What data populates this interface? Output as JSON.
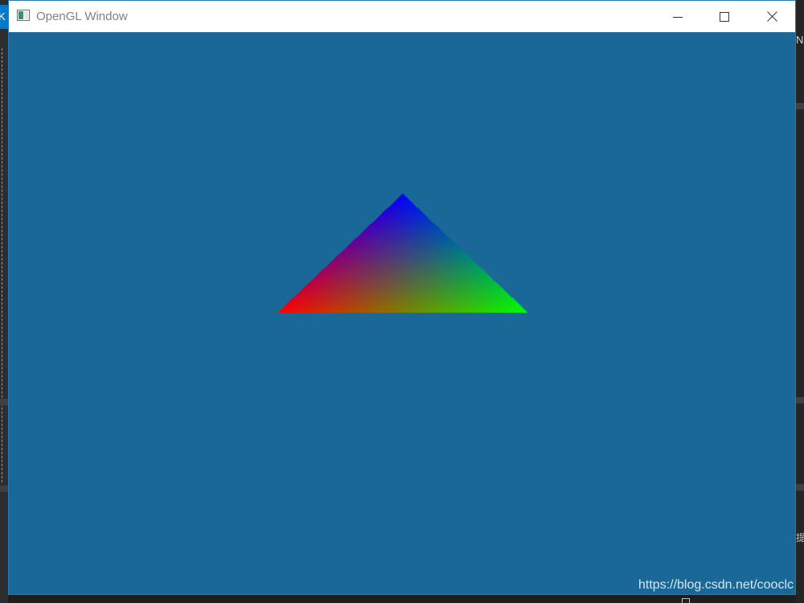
{
  "window": {
    "title": "OpenGL Window",
    "app_icon": "window-app-icon",
    "background_color": "#1a6898",
    "controls": {
      "minimize_icon": "minimize-icon",
      "maximize_icon": "maximize-icon",
      "close_icon": "close-icon"
    }
  },
  "scene": {
    "shape": "triangle",
    "vertex_colors": {
      "left": "#ff0000",
      "right": "#00ff00",
      "top": "#0000ff"
    }
  },
  "background_app": {
    "left_edge_text": "K",
    "right_edge_text": "NS",
    "right_edge_glyph": "提"
  },
  "watermark": {
    "text": "https://blog.csdn.net/cooclc"
  }
}
